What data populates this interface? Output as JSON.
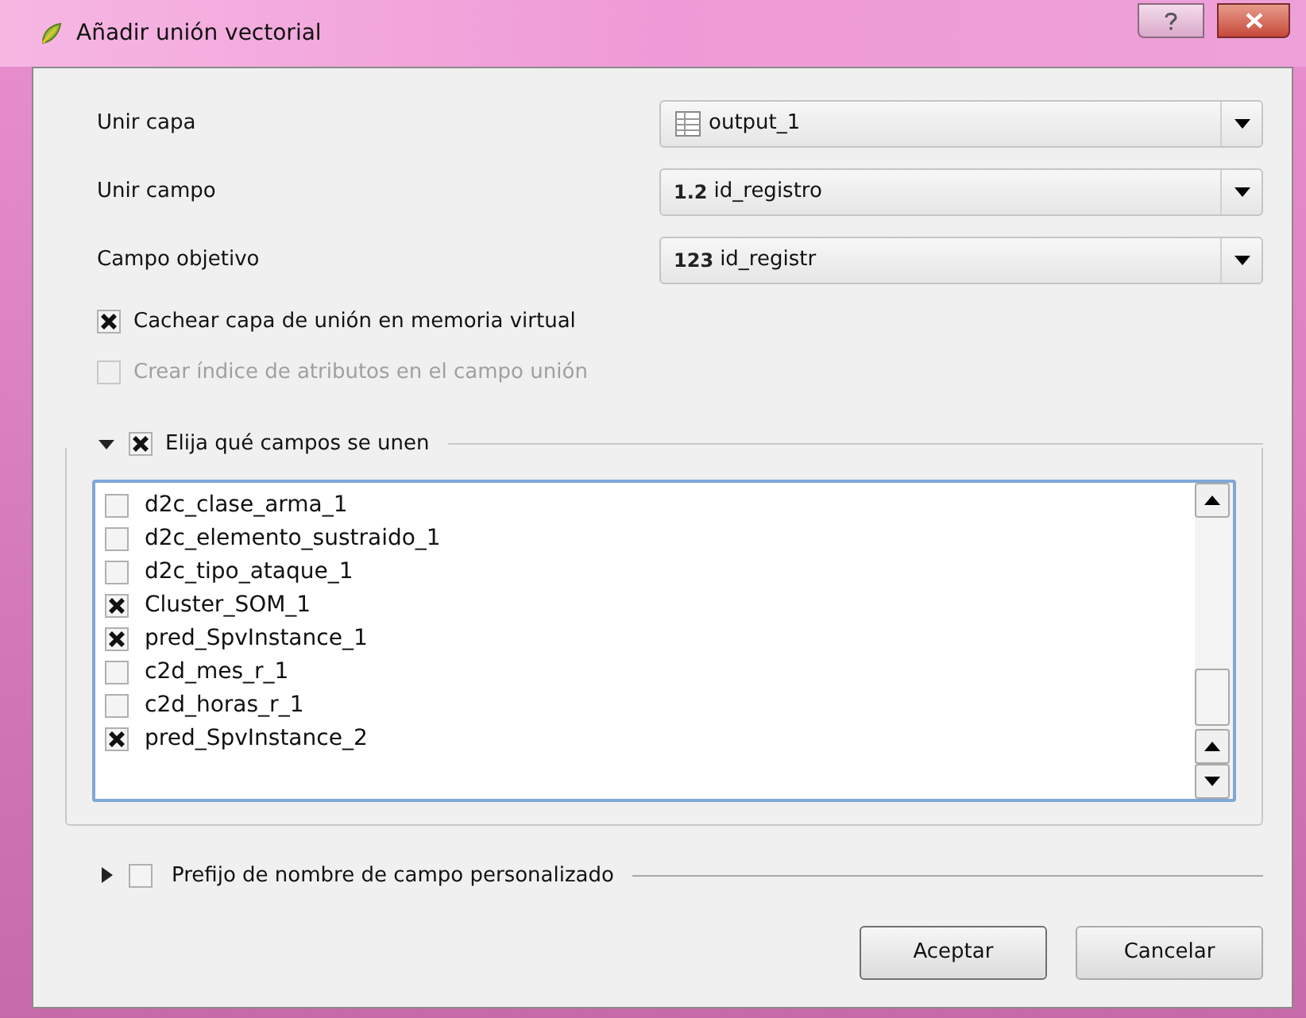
{
  "window": {
    "title": "Añadir unión vectorial"
  },
  "rows": [
    {
      "label": "Unir capa",
      "kind": "layer",
      "value": "output_1"
    },
    {
      "label": "Unir campo",
      "kind": "field",
      "badge": "1.2",
      "value": "id_registro"
    },
    {
      "label": "Campo objetivo",
      "kind": "field",
      "badge": "123",
      "value": "id_registr"
    }
  ],
  "options": [
    {
      "label": "Cachear capa de unión en memoria virtual",
      "checked": true,
      "disabled": false
    },
    {
      "label": "Crear índice de atributos en el campo unión",
      "checked": false,
      "disabled": true
    }
  ],
  "fields_group": {
    "label": "Elija qué campos se unen",
    "expanded": true,
    "checked": true,
    "fields": [
      {
        "name": "d2c_clase_arma_1",
        "checked": false
      },
      {
        "name": "d2c_elemento_sustraido_1",
        "checked": false
      },
      {
        "name": "d2c_tipo_ataque_1",
        "checked": false
      },
      {
        "name": "Cluster_SOM_1",
        "checked": true
      },
      {
        "name": "pred_SpvInstance_1",
        "checked": true
      },
      {
        "name": "c2d_mes_r_1",
        "checked": false
      },
      {
        "name": "c2d_horas_r_1",
        "checked": false
      },
      {
        "name": "pred_SpvInstance_2",
        "checked": true
      }
    ]
  },
  "prefix_group": {
    "label": "Prefijo de nombre de campo personalizado",
    "expanded": false,
    "checked": false
  },
  "buttons": [
    "Aceptar",
    "Cancelar"
  ]
}
